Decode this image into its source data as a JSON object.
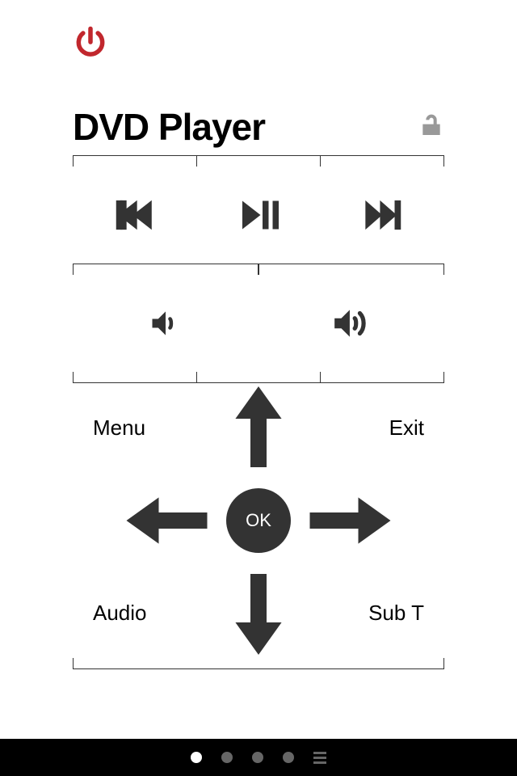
{
  "title": "DVD Player",
  "dpad": {
    "ok": "OK",
    "corners": {
      "tl": "Menu",
      "tr": "Exit",
      "bl": "Audio",
      "br": "Sub T"
    }
  },
  "pager": {
    "count": 4,
    "active": 0
  }
}
